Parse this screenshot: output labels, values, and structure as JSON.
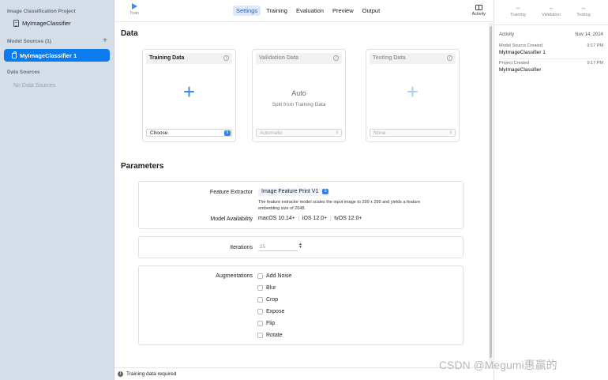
{
  "sidebar": {
    "project_header": "Image Classification Project",
    "project_name": "MyImageClassifier",
    "model_sources_header": "Model Sources (1)",
    "add_symbol": "+",
    "model_source_item": "MyImageClassifier 1",
    "data_sources_header": "Data Sources",
    "no_data_sources": "No Data Sources"
  },
  "toolbar": {
    "train_label": "Train",
    "tabs": [
      "Settings",
      "Training",
      "Evaluation",
      "Preview",
      "Output"
    ],
    "active_tab": "Settings",
    "activity_label": "Activity"
  },
  "data_section": {
    "title": "Data",
    "training": {
      "title": "Training Data",
      "help": "?",
      "plus": "+",
      "select": "Choose"
    },
    "validation": {
      "title": "Validation Data",
      "help": "?",
      "auto_title": "Auto",
      "auto_subtitle": "Split from Training Data",
      "select": "Automatic"
    },
    "testing": {
      "title": "Testing Data",
      "help": "?",
      "plus": "+",
      "select": "None"
    }
  },
  "parameters": {
    "title": "Parameters",
    "feature_extractor_label": "Feature Extractor",
    "feature_extractor_value": "Image Feature Print V1",
    "feature_extractor_desc": "The feature extractor model scales the input image to 299 x 299 and yields a feature embedding size of 2048.",
    "model_availability_label": "Model Availability",
    "os_availability": [
      "macOS 10.14+",
      "iOS 12.0+",
      "tvOS 12.0+"
    ],
    "iterations_label": "Iterations",
    "iterations_value": "25",
    "augmentations_label": "Augmentations",
    "augmentations": [
      "Add Noise",
      "Blur",
      "Crop",
      "Expose",
      "Flip",
      "Rotate"
    ]
  },
  "status": {
    "info_symbol": "i",
    "message": "Training data required"
  },
  "right_panel": {
    "metrics": [
      {
        "value": "--",
        "label": "Training"
      },
      {
        "value": "--",
        "label": "Validation"
      },
      {
        "value": "--",
        "label": "Testing"
      }
    ],
    "activity_header": "Activity",
    "activity_date": "Nov 14, 2024",
    "entries": [
      {
        "event": "Model Source Created",
        "time": "9:17 PM",
        "name": "MyImageClassifier 1"
      },
      {
        "event": "Project Created",
        "time": "9:17 PM",
        "name": "MyImageClassifier"
      }
    ]
  },
  "watermark": "CSDN @Megumi惠赢的",
  "colors": {
    "accent": "#0a7cf0",
    "sidebar_bg": "#d5dde8",
    "tab_active_bg": "#dce9fb"
  }
}
